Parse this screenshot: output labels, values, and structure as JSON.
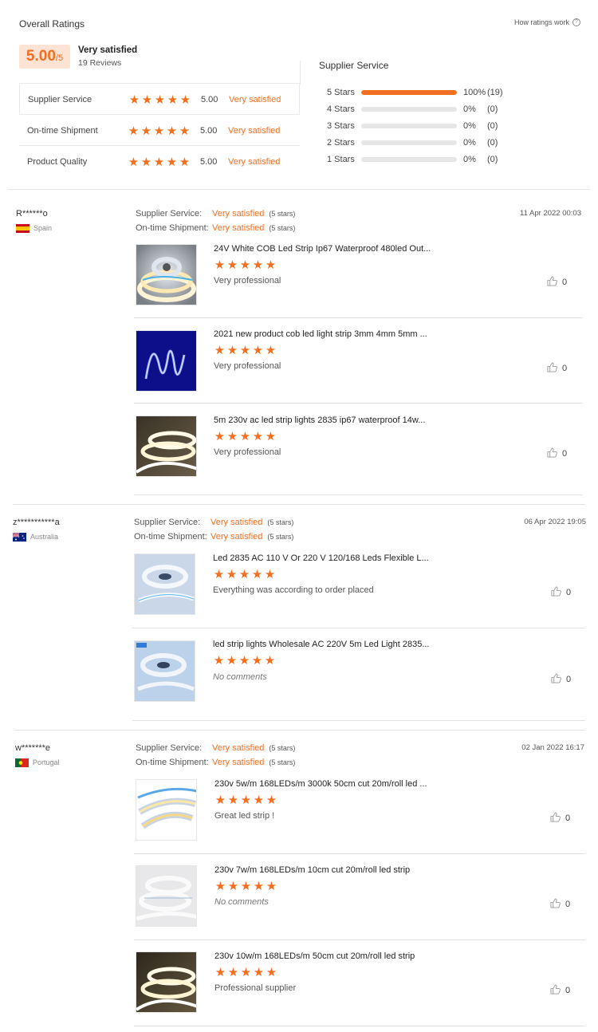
{
  "summary": {
    "title": "Overall Ratings",
    "how_link": "How ratings work",
    "score": "5.00",
    "score_denom": "/5",
    "score_label": "Very satisfied",
    "reviews_count": "19 Reviews",
    "categories": [
      {
        "label": "Supplier Service",
        "value": "5.00",
        "sat": "Very satisfied"
      },
      {
        "label": "On-time Shipment",
        "value": "5.00",
        "sat": "Very satisfied"
      },
      {
        "label": "Product Quality",
        "value": "5.00",
        "sat": "Very satisfied"
      }
    ],
    "dist_title": "Supplier Service",
    "distribution": [
      {
        "label": "5 Stars",
        "fraction": 1.0,
        "pct": "100%",
        "count": "(19)"
      },
      {
        "label": "4 Stars",
        "fraction": 0,
        "pct": "0%",
        "count": "(0)"
      },
      {
        "label": "3 Stars",
        "fraction": 0,
        "pct": "0%",
        "count": "(0)"
      },
      {
        "label": "2 Stars",
        "fraction": 0,
        "pct": "0%",
        "count": "(0)"
      },
      {
        "label": "1 Stars",
        "fraction": 0,
        "pct": "0%",
        "count": "(0)"
      }
    ]
  },
  "labels": {
    "supplier_service": "Supplier Service:",
    "ontime": "On-time Shipment:",
    "very_satisfied": "Very satisfied",
    "five_stars": "(5 stars)"
  },
  "reviews": [
    {
      "user": "R******o",
      "country": "Spain",
      "date": "11 Apr 2022 00:03",
      "items": [
        {
          "title": "24V White COB Led Strip Ip67 Waterproof 480led Out...",
          "comment": "Very professional",
          "likes": "0"
        },
        {
          "title": "2021 new product cob led light strip 3mm 4mm 5mm ...",
          "comment": "Very professional",
          "likes": "0"
        },
        {
          "title": "5m 230v ac led strip lights 2835 ip67 waterproof 14w...",
          "comment": "Very professional",
          "likes": "0"
        }
      ]
    },
    {
      "user": "z***********a",
      "country": "Australia",
      "date": "06 Apr 2022 19:05",
      "items": [
        {
          "title": "Led 2835 AC 110 V Or 220 V 120/168 Leds Flexible L...",
          "comment": "Everything was according to order placed",
          "likes": "0"
        },
        {
          "title": "led strip lights Wholesale AC 220V 5m Led Light 2835...",
          "comment": "No comments",
          "likes": "0"
        }
      ]
    },
    {
      "user": "w*******e",
      "country": "Portugal",
      "date": "02 Jan 2022 16:17",
      "items": [
        {
          "title": "230v 5w/m 168LEDs/m 3000k 50cm cut 20m/roll led ...",
          "comment": "Great led strip !",
          "likes": "0"
        },
        {
          "title": "230v 7w/m 168LEDs/m 10cm cut 20m/roll led strip",
          "comment": "No comments",
          "likes": "0"
        },
        {
          "title": "230v 10w/m 168LEDs/m 50cm cut 20m/roll led strip",
          "comment": "Professional supplier",
          "likes": "0"
        }
      ]
    }
  ],
  "colors": {
    "accent": "#f26f21",
    "bar_bg": "#e6e6e6"
  }
}
